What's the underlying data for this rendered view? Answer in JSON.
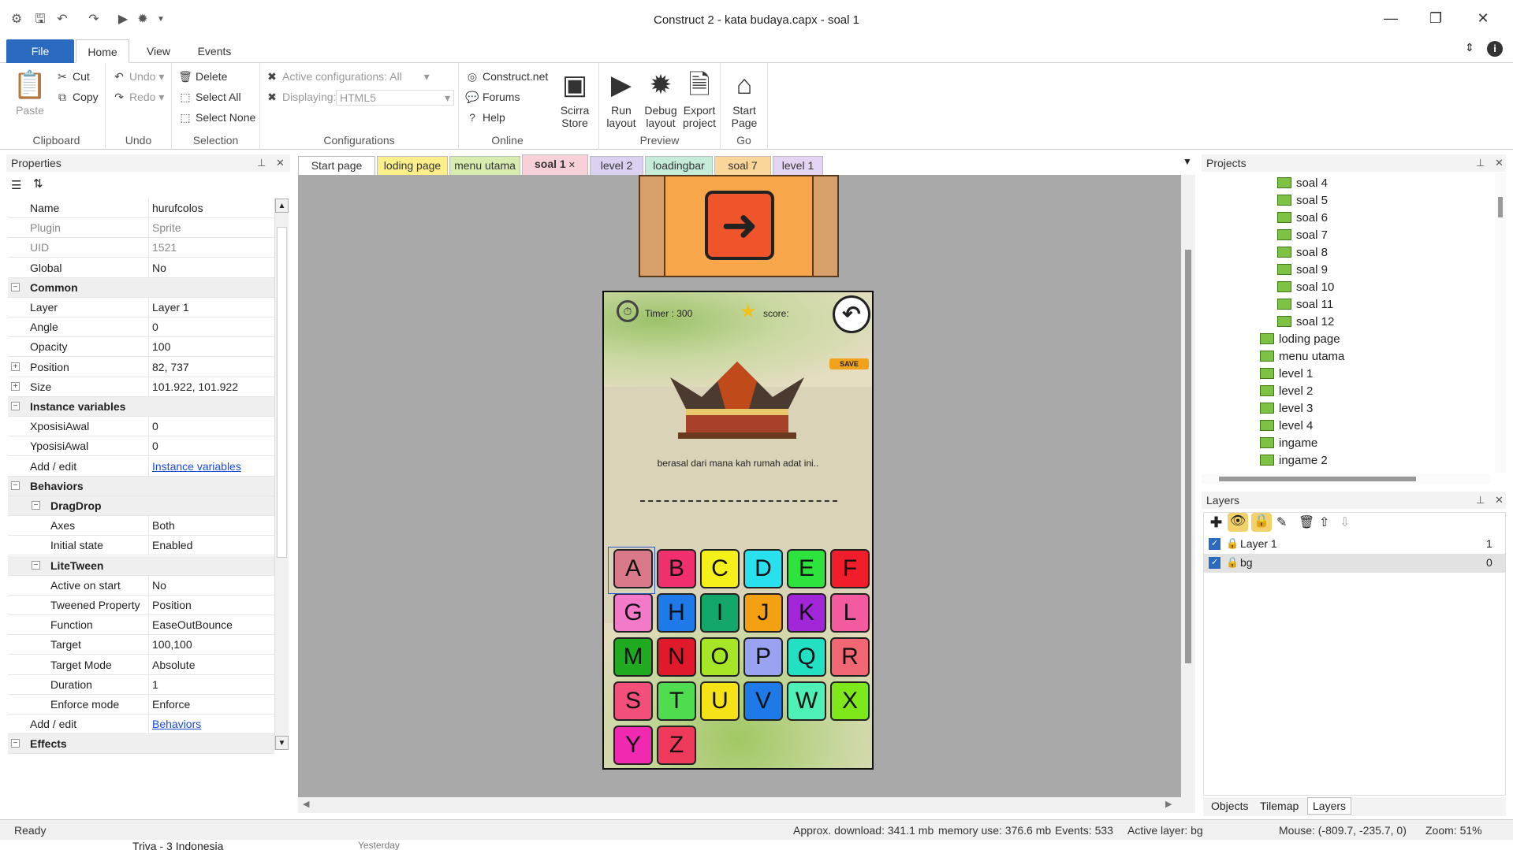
{
  "window": {
    "title": "Construct 2 - kata budaya.capx - soal 1",
    "minimize": "—",
    "restore": "❐",
    "close": "✕"
  },
  "ribbon_tabs": [
    "File",
    "Home",
    "View",
    "Events"
  ],
  "ribbon": {
    "clipboard": {
      "paste": "Paste",
      "cut": "Cut",
      "copy": "Copy",
      "label": "Clipboard"
    },
    "undo": {
      "undo": "Undo",
      "redo": "Redo",
      "label": "Undo"
    },
    "selection": {
      "delete": "Delete",
      "select_all": "Select All",
      "select_none": "Select None",
      "label": "Selection"
    },
    "configurations": {
      "active": "Active configurations: All",
      "displaying_label": "Displaying:",
      "displaying_value": "HTML5",
      "label": "Configurations"
    },
    "online": {
      "construct": "Construct.net",
      "forums": "Forums",
      "help": "Help",
      "label": "Online"
    },
    "store": {
      "line1": "Scirra",
      "line2": "Store"
    },
    "preview": {
      "run": [
        "Run",
        "layout"
      ],
      "debug": [
        "Debug",
        "layout"
      ],
      "export": [
        "Export",
        "project"
      ],
      "label": "Preview"
    },
    "go": {
      "start": [
        "Start",
        "Page"
      ],
      "label": "Go"
    }
  },
  "properties": {
    "title": "Properties",
    "rows": [
      {
        "k": "Name",
        "v": "hurufcolos"
      },
      {
        "k": "Plugin",
        "v": "Sprite"
      },
      {
        "k": "UID",
        "v": "1521"
      },
      {
        "k": "Global",
        "v": "No"
      },
      {
        "k": "Common",
        "v": ""
      },
      {
        "k": "Layer",
        "v": "Layer 1"
      },
      {
        "k": "Angle",
        "v": "0"
      },
      {
        "k": "Opacity",
        "v": "100"
      },
      {
        "k": "Position",
        "v": "82, 737"
      },
      {
        "k": "Size",
        "v": "101.922, 101.922"
      },
      {
        "k": "Instance variables",
        "v": ""
      },
      {
        "k": "XposisiAwal",
        "v": "0"
      },
      {
        "k": "YposisiAwal",
        "v": "0"
      },
      {
        "k": "Add / edit",
        "v": "Instance variables"
      },
      {
        "k": "Behaviors",
        "v": ""
      },
      {
        "k": "DragDrop",
        "v": ""
      },
      {
        "k": "Axes",
        "v": "Both"
      },
      {
        "k": "Initial state",
        "v": "Enabled"
      },
      {
        "k": "LiteTween",
        "v": ""
      },
      {
        "k": "Active on start",
        "v": "No"
      },
      {
        "k": "Tweened Property",
        "v": "Position"
      },
      {
        "k": "Function",
        "v": "EaseOutBounce"
      },
      {
        "k": "Target",
        "v": "100,100"
      },
      {
        "k": "Target Mode",
        "v": "Absolute"
      },
      {
        "k": "Duration",
        "v": "1"
      },
      {
        "k": "Enforce mode",
        "v": "Enforce"
      },
      {
        "k": "Add / edit",
        "v": "Behaviors"
      },
      {
        "k": "Effects",
        "v": ""
      }
    ]
  },
  "doc_tabs": [
    "Start page",
    "loding page",
    "menu utama",
    "soal 1",
    "level 2",
    "loadingbar",
    "soal 7",
    "level 1"
  ],
  "game": {
    "timer": "Timer : 300",
    "score": "score:",
    "save": "SAVE",
    "question": "berasal dari mana kah rumah adat ini..",
    "letters": [
      "A",
      "B",
      "C",
      "D",
      "E",
      "F",
      "G",
      "H",
      "I",
      "J",
      "K",
      "L",
      "M",
      "N",
      "O",
      "P",
      "Q",
      "R",
      "S",
      "T",
      "U",
      "V",
      "W",
      "X",
      "Y",
      "Z"
    ],
    "letter_colors": [
      "#d9798a",
      "#f0306e",
      "#f5ef1a",
      "#28e0ee",
      "#2ee33e",
      "#f01d2a",
      "#f27ac9",
      "#1d7ae8",
      "#13a86a",
      "#f3a012",
      "#a026d8",
      "#f45aa0",
      "#1faa22",
      "#e01a2a",
      "#a6e626",
      "#9aa2f2",
      "#22e0c2",
      "#f06672",
      "#f2507a",
      "#4fdc4f",
      "#f5e318",
      "#1d7ae8",
      "#4ff0b8",
      "#7ee81a",
      "#f029b0",
      "#ee3a5a"
    ]
  },
  "projects": {
    "title": "Projects",
    "items": [
      "soal 4",
      "soal 5",
      "soal 6",
      "soal 7",
      "soal 8",
      "soal 9",
      "soal 10",
      "soal 11",
      "soal 12",
      "loding page",
      "menu utama",
      "level 1",
      "level 2",
      "level 3",
      "level 4",
      "ingame",
      "ingame 2"
    ]
  },
  "layers": {
    "title": "Layers",
    "rows": [
      {
        "name": "Layer 1",
        "num": "1"
      },
      {
        "name": "bg",
        "num": "0"
      }
    ],
    "bottom_tabs": [
      "Objects",
      "Tilemap",
      "Layers"
    ]
  },
  "status": {
    "ready": "Ready",
    "download": "Approx. download: 341.1 mb",
    "memory": "memory use: 376.6 mb",
    "events": "Events: 533",
    "layer": "Active layer: bg",
    "mouse": "Mouse: (-809.7, -235.7, 0)",
    "zoom": "Zoom: 51%"
  },
  "taskbar_peek": {
    "name": "Triva - 3 Indonesia",
    "time": "Yesterday"
  }
}
